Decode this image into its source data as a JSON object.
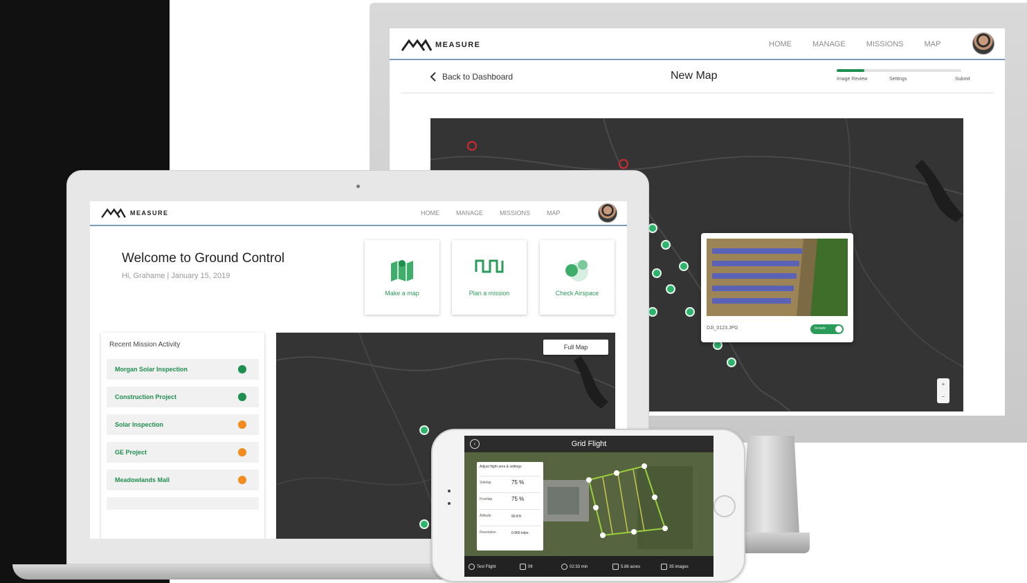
{
  "brand": {
    "name": "MEASURE"
  },
  "desktop": {
    "nav": [
      "HOME",
      "MANAGE",
      "MISSIONS",
      "MAP"
    ],
    "back_label": "Back to Dashboard",
    "page_title": "New Map",
    "progress": {
      "fraction": 0.22,
      "steps": [
        "Image Review",
        "Settings",
        "Submit"
      ]
    },
    "popup": {
      "filename": "DJI_0123.JPG",
      "toggle_label": "Include"
    },
    "zoom": {
      "in": "+",
      "out": "−"
    }
  },
  "laptop": {
    "nav": [
      "HOME",
      "MANAGE",
      "MISSIONS",
      "MAP"
    ],
    "welcome_title": "Welcome to Ground Control",
    "greeting": "Hi, Grahame | January 15, 2019",
    "actions": [
      {
        "label": "Make a map",
        "icon": "map-icon"
      },
      {
        "label": "Plan a mission",
        "icon": "flight-path-icon"
      },
      {
        "label": "Check Airspace",
        "icon": "airspace-icon"
      }
    ],
    "activity": {
      "title": "Recent Mission Activity",
      "items": [
        {
          "name": "Morgan Solar Inspection",
          "status_color": "#1e8f4f"
        },
        {
          "name": "Construction Project",
          "status_color": "#1e8f4f"
        },
        {
          "name": "Solar Inspection",
          "status_color": "#f28c1e"
        },
        {
          "name": "GE Project",
          "status_color": "#f28c1e"
        },
        {
          "name": "Meadowlands Mall",
          "status_color": "#f28c1e"
        }
      ]
    },
    "full_map_label": "Full Map"
  },
  "phone": {
    "title": "Grid Flight",
    "panel_title": "Adjust flight area & settings",
    "settings": [
      {
        "key": "Sidelap",
        "value": "75 %"
      },
      {
        "key": "Frontlap",
        "value": "75 %"
      },
      {
        "key": "Altitude",
        "value": "90.8 ft"
      },
      {
        "key": "Resolution",
        "value": "0.960 in/px"
      }
    ],
    "bottom": [
      {
        "label": "Test Flight",
        "icon": "check-icon"
      },
      {
        "label": "0ft",
        "icon": "altitude-icon"
      },
      {
        "label": "02:33 min",
        "icon": "timer-icon"
      },
      {
        "label": "5.88 acres",
        "icon": "area-icon"
      },
      {
        "label": "35 images",
        "icon": "images-icon"
      }
    ]
  },
  "colors": {
    "accent_green": "#1e8f4f",
    "warning_orange": "#f28c1e",
    "map_dark": "#343434",
    "header_rule": "#7a9cb6"
  }
}
